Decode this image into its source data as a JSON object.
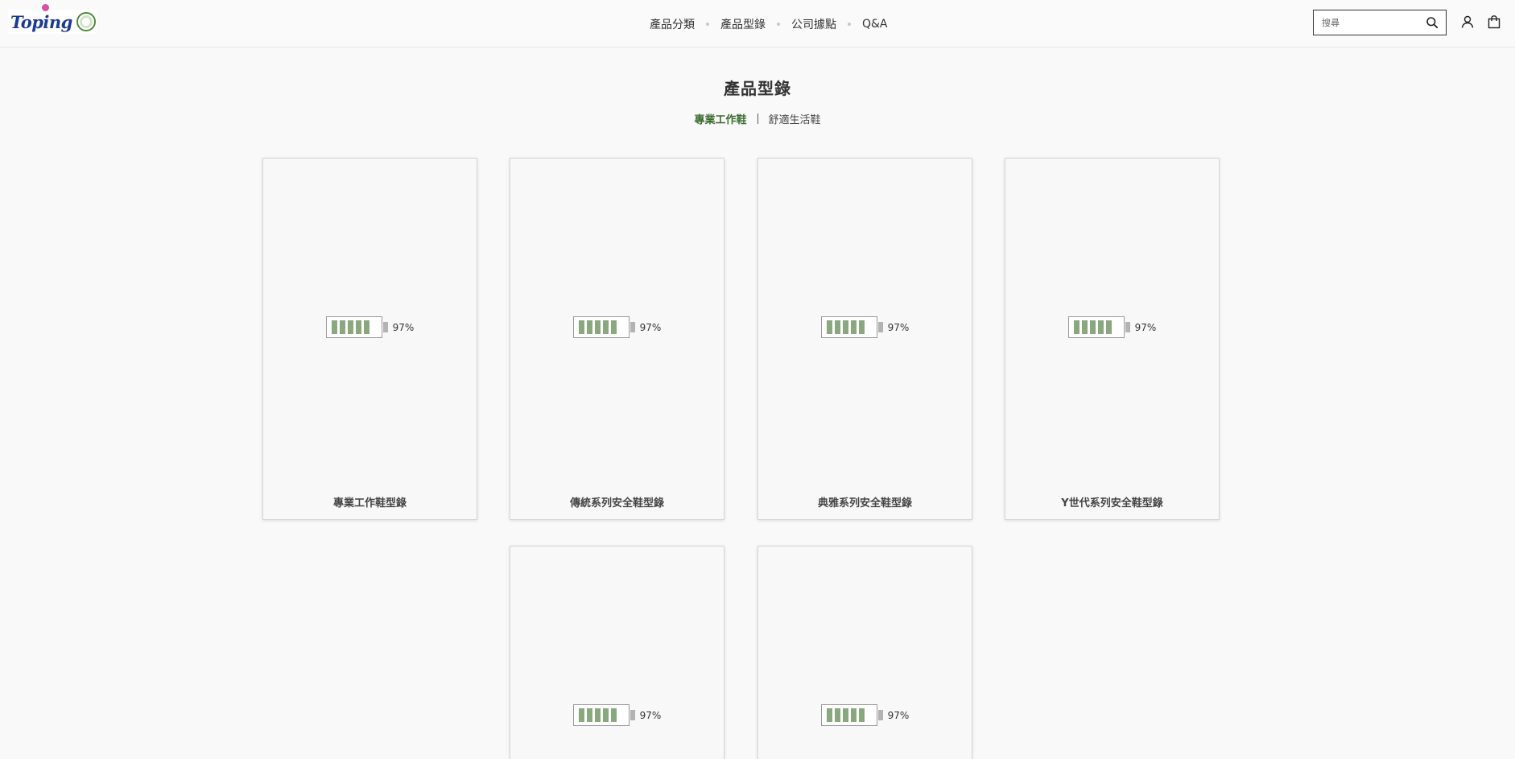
{
  "brand": {
    "logo_text": "Toping"
  },
  "nav": {
    "items": [
      {
        "label": "產品分類"
      },
      {
        "label": "產品型錄"
      },
      {
        "label": "公司據點"
      },
      {
        "label": "Q&A"
      }
    ]
  },
  "search": {
    "placeholder": "搜尋"
  },
  "icons": {
    "search": "search-icon",
    "account": "user-icon",
    "cart": "shopping-bag-icon"
  },
  "colors": {
    "accent": "#3a6b2e",
    "battery_cell": "#8aa87e"
  },
  "page": {
    "title": "產品型錄"
  },
  "subtabs": [
    {
      "label": "專業工作鞋",
      "active": true
    },
    {
      "label": "舒適生活鞋",
      "active": false
    }
  ],
  "catalogs": [
    {
      "title": "專業工作鞋型錄",
      "loading_percent": "97%"
    },
    {
      "title": "傳統系列安全鞋型錄",
      "loading_percent": "97%"
    },
    {
      "title": "典雅系列安全鞋型錄",
      "loading_percent": "97%"
    },
    {
      "title": "Y世代系列安全鞋型錄",
      "loading_percent": "97%"
    },
    {
      "title": "",
      "loading_percent": "97%"
    },
    {
      "title": "",
      "loading_percent": "97%"
    }
  ]
}
